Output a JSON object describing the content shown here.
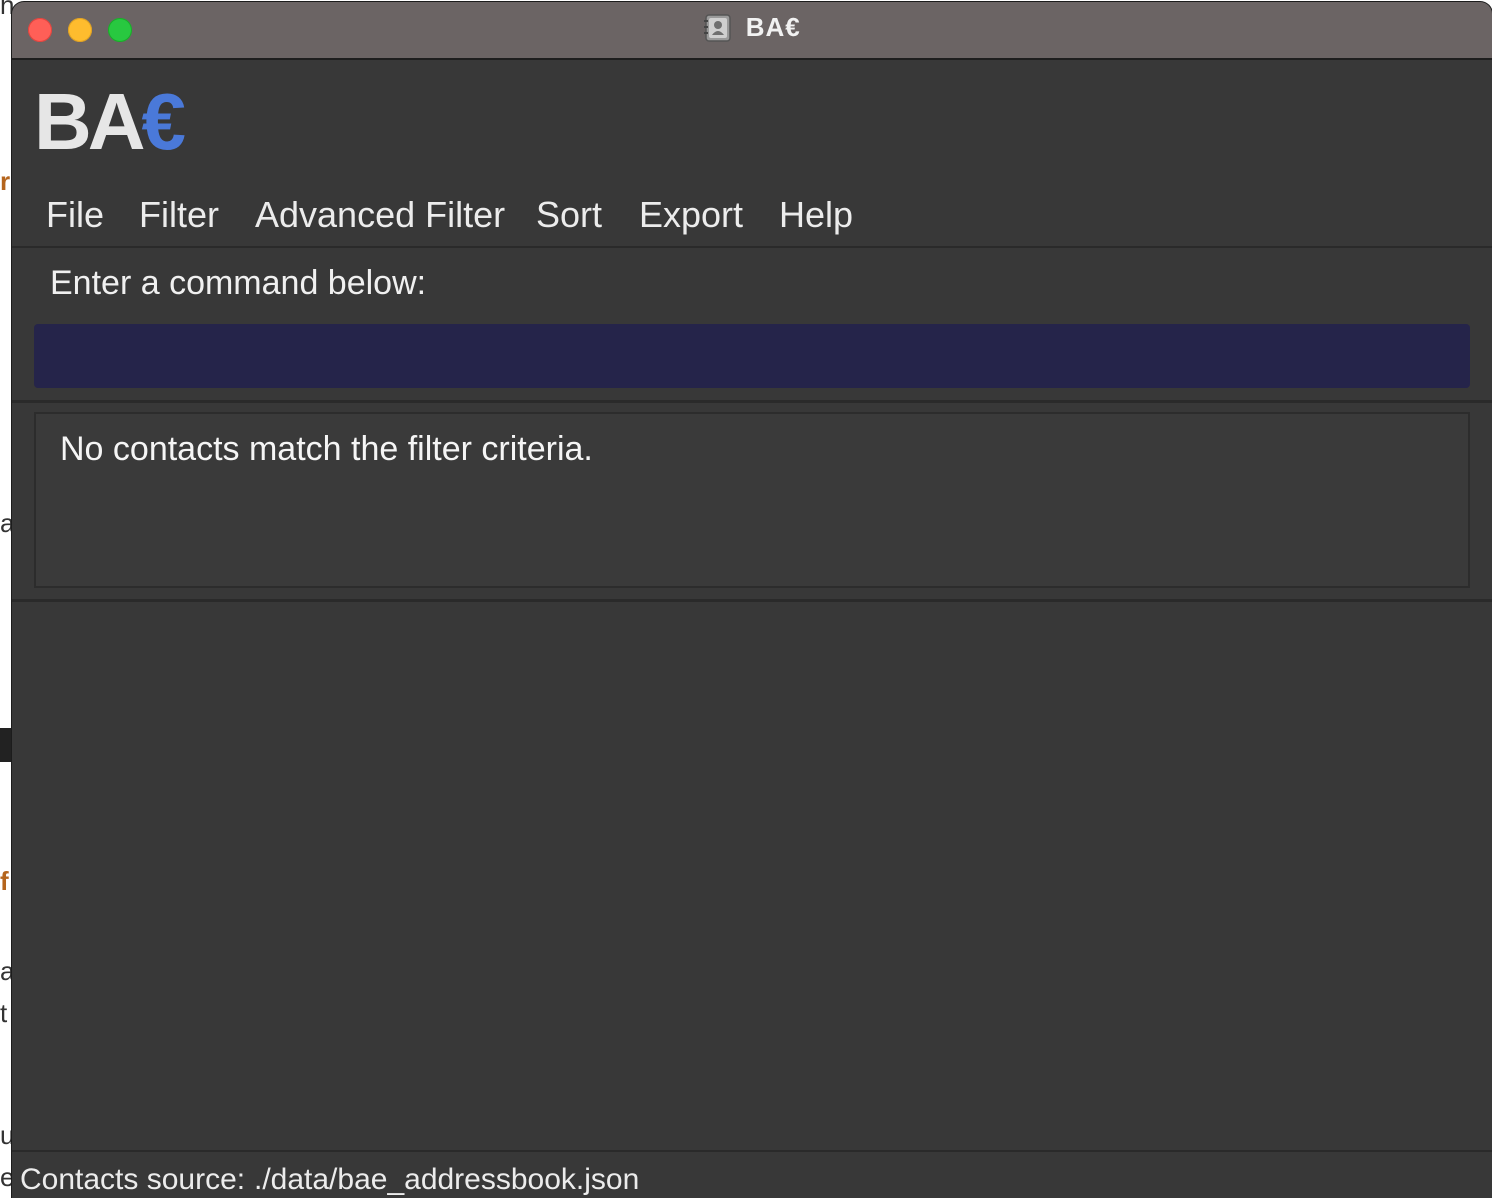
{
  "background_fragments": [
    "h",
    "r",
    "a",
    "f",
    "a",
    "t",
    "u",
    "e"
  ],
  "window": {
    "title": "BA€",
    "app_icon": "address-book-icon"
  },
  "logo": {
    "main": "BA",
    "euro": "€",
    "euro_color": "#4a79d9"
  },
  "menu": {
    "items": [
      "File",
      "Filter",
      "Advanced Filter",
      "Sort",
      "Export",
      "Help"
    ]
  },
  "command": {
    "label": "Enter a command below:",
    "value": "",
    "input_color": "#25244a"
  },
  "result": {
    "message": "No contacts match the filter criteria."
  },
  "status": {
    "label": "Contacts source:",
    "value": "./data/bae_addressbook.json"
  }
}
